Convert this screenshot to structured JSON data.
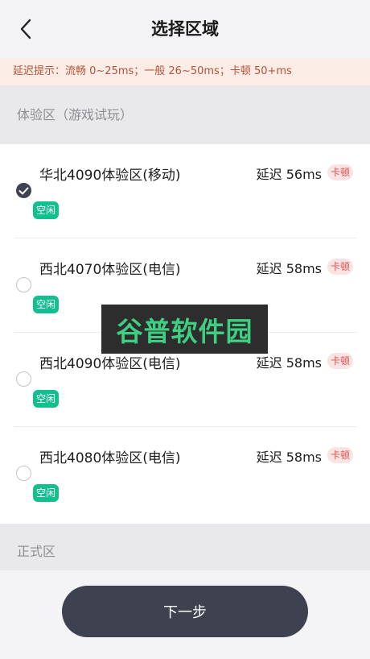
{
  "header": {
    "title": "选择区域",
    "back_icon": "chevron-left-icon"
  },
  "tip": "延迟提示：流畅 0~25ms；一般 26~50ms；卡顿 50+ms",
  "sections": {
    "trial": "体验区（游戏试玩）",
    "formal": "正式区"
  },
  "servers": [
    {
      "name": "华北4090体验区(移动)",
      "latency": "延迟 56ms",
      "lag_tag": "卡顿",
      "status": "空闲",
      "selected": true
    },
    {
      "name": "西北4070体验区(电信)",
      "latency": "延迟 58ms",
      "lag_tag": "卡顿",
      "status": "空闲",
      "selected": false
    },
    {
      "name": "西北4090体验区(电信)",
      "latency": "延迟 58ms",
      "lag_tag": "卡顿",
      "status": "空闲",
      "selected": false
    },
    {
      "name": "西北4080体验区(电信)",
      "latency": "延迟 58ms",
      "lag_tag": "卡顿",
      "status": "空闲",
      "selected": false
    }
  ],
  "watermark": "谷普软件园",
  "next_button": "下一步",
  "colors": {
    "accent_dark": "#3e4150",
    "free_tag": "#12c08f",
    "lag_tag": "#d9534f",
    "tip_text": "#b3533a"
  }
}
